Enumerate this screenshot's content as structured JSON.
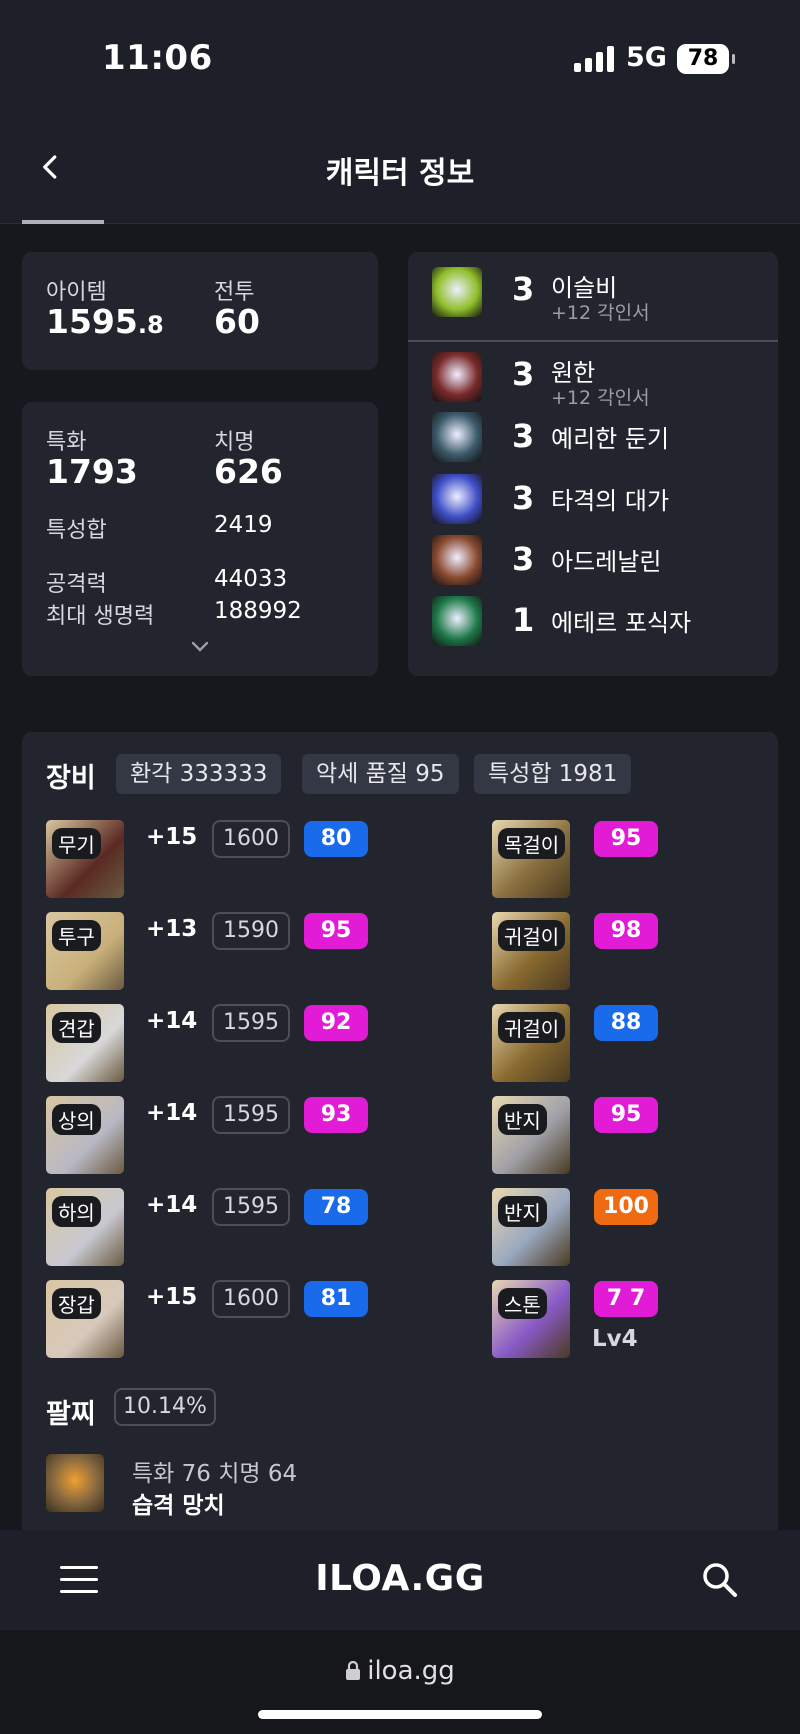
{
  "status_bar": {
    "time": "11:06",
    "network": "5G",
    "battery": "78"
  },
  "header": {
    "title": "캐릭터 정보"
  },
  "summary": {
    "item_label": "아이템",
    "item_level_int": "1595",
    "item_level_dec": ".8",
    "combat_label": "전투",
    "combat_level": "60"
  },
  "stats": {
    "spec_label": "특화",
    "spec_value": "1793",
    "crit_label": "치명",
    "crit_value": "626",
    "total_label": "특성합",
    "total_value": "2419",
    "atk_label": "공격력",
    "atk_value": "44033",
    "hp_label": "최대 생명력",
    "hp_value": "188992"
  },
  "engravings": [
    {
      "level": "3",
      "name": "이슬비",
      "sub": "+12 각인서",
      "color": "#8fbf2a"
    },
    {
      "level": "3",
      "name": "원한",
      "sub": "+12 각인서",
      "color": "#7a2a2a"
    },
    {
      "level": "3",
      "name": "예리한 둔기",
      "sub": "",
      "color": "#3b5a6a"
    },
    {
      "level": "3",
      "name": "타격의 대가",
      "sub": "",
      "color": "#3f4fc8"
    },
    {
      "level": "3",
      "name": "아드레날린",
      "sub": "",
      "color": "#8a4a30"
    },
    {
      "level": "1",
      "name": "에테르 포식자",
      "sub": "",
      "color": "#1f7a4a"
    }
  ],
  "equipment": {
    "title": "장비",
    "chips": [
      "환각 333333",
      "악세 품질 95",
      "특성합 1981"
    ],
    "left": [
      {
        "tag": "무기",
        "plus": "+15",
        "level": "1600",
        "quality": "80",
        "qcolor": "#1a6aec"
      },
      {
        "tag": "투구",
        "plus": "+13",
        "level": "1590",
        "quality": "95",
        "qcolor": "#e21cd6"
      },
      {
        "tag": "견갑",
        "plus": "+14",
        "level": "1595",
        "quality": "92",
        "qcolor": "#e21cd6"
      },
      {
        "tag": "상의",
        "plus": "+14",
        "level": "1595",
        "quality": "93",
        "qcolor": "#e21cd6"
      },
      {
        "tag": "하의",
        "plus": "+14",
        "level": "1595",
        "quality": "78",
        "qcolor": "#1a6aec"
      },
      {
        "tag": "장갑",
        "plus": "+15",
        "level": "1600",
        "quality": "81",
        "qcolor": "#1a6aec"
      }
    ],
    "right": [
      {
        "tag": "목걸이",
        "quality": "95",
        "qcolor": "#e21cd6",
        "extra": ""
      },
      {
        "tag": "귀걸이",
        "quality": "98",
        "qcolor": "#e21cd6",
        "extra": ""
      },
      {
        "tag": "귀걸이",
        "quality": "88",
        "qcolor": "#1a6aec",
        "extra": ""
      },
      {
        "tag": "반지",
        "quality": "95",
        "qcolor": "#e21cd6",
        "extra": ""
      },
      {
        "tag": "반지",
        "quality": "100",
        "qcolor": "#ef6a10",
        "extra": ""
      },
      {
        "tag": "스톤",
        "quality": "7 7",
        "qcolor": "#e21cd6",
        "extra": "Lv4"
      }
    ]
  },
  "bracelet": {
    "title": "팔찌",
    "percent": "10.14%",
    "line1": "특화 76  치명 64",
    "line2": "습격  망치"
  },
  "bottom": {
    "logo": "ILOA.GG"
  },
  "browser": {
    "url": "iloa.gg"
  }
}
